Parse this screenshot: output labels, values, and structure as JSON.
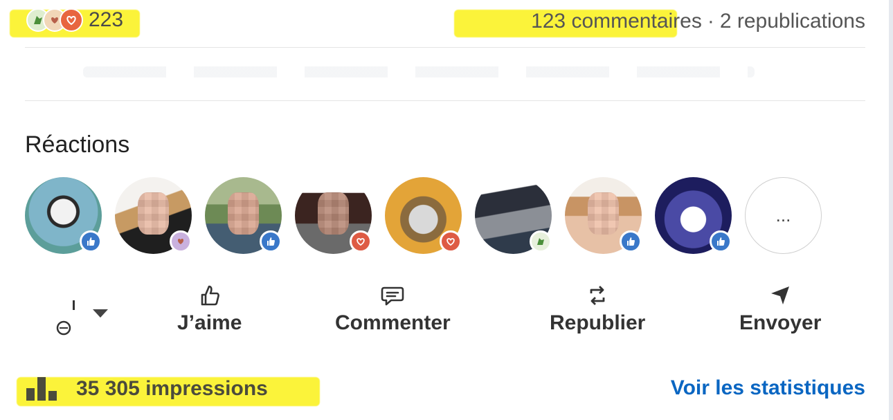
{
  "summary": {
    "reaction_count": "223",
    "comments": "123 commentaires",
    "separator": "·",
    "reposts": "2 republications",
    "reaction_types": [
      "celebrate-icon",
      "support-icon",
      "love-icon"
    ]
  },
  "reactions": {
    "title": "Réactions",
    "avatars": [
      {
        "reaction": "like"
      },
      {
        "reaction": "support"
      },
      {
        "reaction": "like"
      },
      {
        "reaction": "love"
      },
      {
        "reaction": "love"
      },
      {
        "reaction": "celebrate"
      },
      {
        "reaction": "like"
      },
      {
        "reaction": "like"
      }
    ],
    "more_label": "..."
  },
  "actions": {
    "like": "J’aime",
    "comment": "Commenter",
    "repost": "Republier",
    "send": "Envoyer"
  },
  "footer": {
    "impressions": "35 305 impressions",
    "stats_link": "Voir les statistiques"
  },
  "colors": {
    "highlight": "#fbf33a",
    "link": "#0a66c2",
    "like": "#3a78c9",
    "love": "#de5b44"
  }
}
